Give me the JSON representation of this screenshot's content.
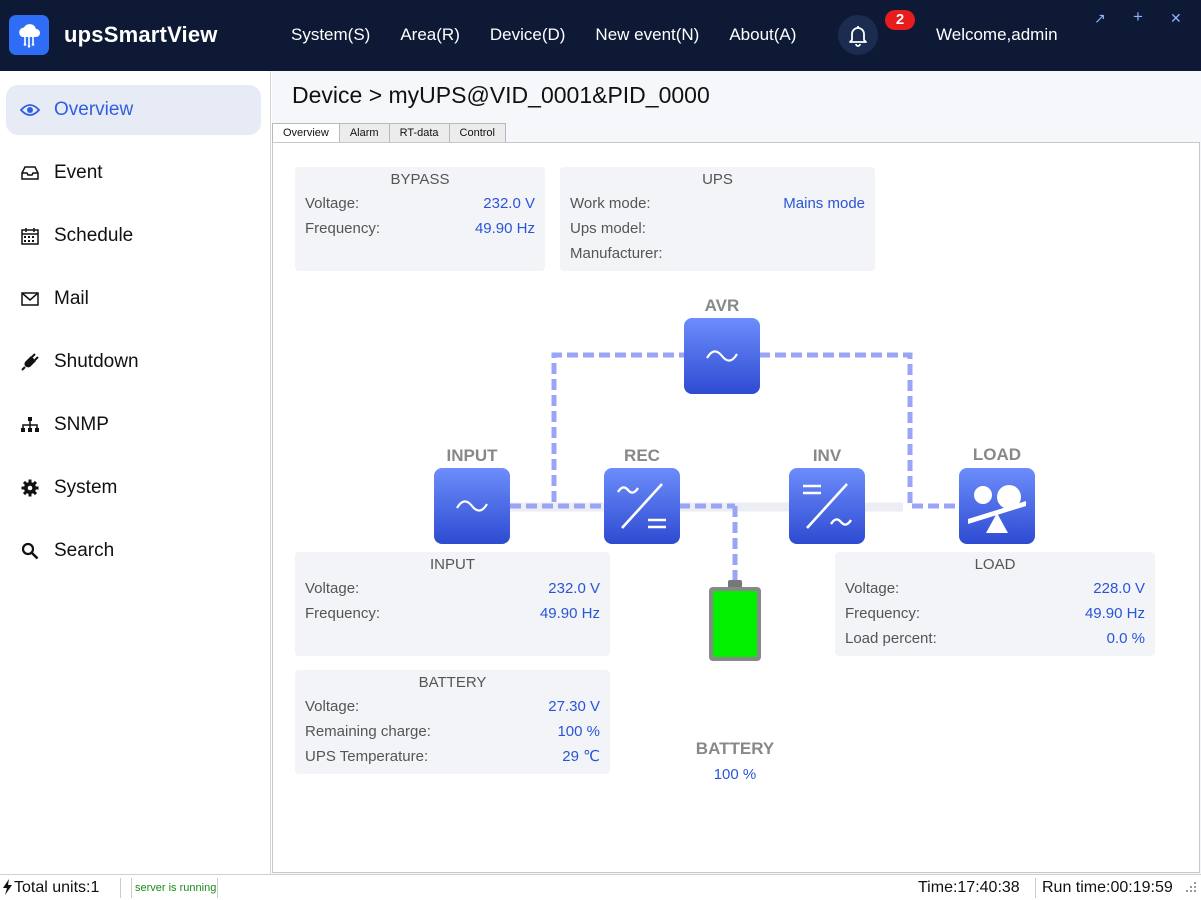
{
  "header": {
    "app_title": "upsSmartView",
    "menu": [
      "System(S)",
      "Area(R)",
      "Device(D)",
      "New event(N)",
      "About(A)"
    ],
    "notification_count": "2",
    "welcome": "Welcome,admin",
    "window_controls": [
      "↗",
      "+",
      "✕"
    ]
  },
  "sidebar": {
    "items": [
      {
        "label": "Overview",
        "icon": "eye-icon",
        "active": true
      },
      {
        "label": "Event",
        "icon": "inbox-icon"
      },
      {
        "label": "Schedule",
        "icon": "calendar-icon"
      },
      {
        "label": "Mail",
        "icon": "mail-icon"
      },
      {
        "label": "Shutdown",
        "icon": "plug-icon"
      },
      {
        "label": "SNMP",
        "icon": "network-icon"
      },
      {
        "label": "System",
        "icon": "gear-icon"
      },
      {
        "label": "Search",
        "icon": "search-icon"
      }
    ]
  },
  "main": {
    "breadcrumb": "Device > myUPS@VID_0001&PID_0000",
    "tabs": [
      "Overview",
      "Alarm",
      "RT-data",
      "Control"
    ],
    "bypass": {
      "title": "BYPASS",
      "voltage_label": "Voltage:",
      "voltage": "232.0 V",
      "frequency_label": "Frequency:",
      "frequency": "49.90 Hz"
    },
    "ups": {
      "title": "UPS",
      "work_mode_label": "Work mode:",
      "work_mode": "Mains mode",
      "model_label": "Ups model:",
      "model": "",
      "manufacturer_label": "Manufacturer:",
      "manufacturer": ""
    },
    "input": {
      "title": "INPUT",
      "voltage_label": "Voltage:",
      "voltage": "232.0 V",
      "frequency_label": "Frequency:",
      "frequency": "49.90 Hz"
    },
    "battery": {
      "title": "BATTERY",
      "voltage_label": "Voltage:",
      "voltage": "27.30 V",
      "charge_label": "Remaining charge:",
      "charge": "100 %",
      "temp_label": "UPS Temperature:",
      "temp": "29 ℃"
    },
    "load": {
      "title": "LOAD",
      "voltage_label": "Voltage:",
      "voltage": "228.0 V",
      "frequency_label": "Frequency:",
      "frequency": "49.90 Hz",
      "percent_label": "Load percent:",
      "percent": "0.0 %"
    },
    "diagram": {
      "avr": "AVR",
      "input": "INPUT",
      "rec": "REC",
      "inv": "INV",
      "load": "LOAD",
      "battery": "BATTERY",
      "battery_percent": "100 %",
      "battery_level": 1.0,
      "flow_color": "#9aa6f5",
      "battery_color": "#00f000"
    }
  },
  "status": {
    "total_units": "Total units:1",
    "server": "server is running",
    "time": "Time:17:40:38",
    "run_time": "Run time:00:19:59"
  }
}
